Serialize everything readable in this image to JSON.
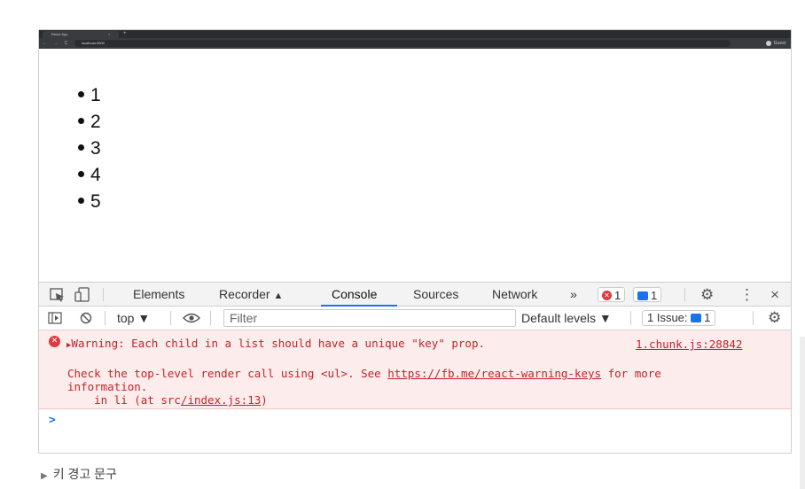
{
  "browser": {
    "tab_title": "React App",
    "tab_close": "×",
    "new_tab": "+",
    "url": "localhost:3000",
    "nav_glyphs": "← → C",
    "profile_label": "Guest"
  },
  "page": {
    "list_items": [
      "1",
      "2",
      "3",
      "4",
      "5"
    ]
  },
  "devtools": {
    "tabs": [
      "Elements",
      "Recorder",
      "Console",
      "Sources",
      "Network"
    ],
    "recorder_glyph": "▲",
    "more_tabs": "»",
    "error_count": "1",
    "message_count": "1",
    "more_menu": "⋮",
    "close": "×",
    "gear": "⚙",
    "context": "top ▼",
    "filter_placeholder": "Filter",
    "default_levels": "Default levels ▼",
    "issues_label": "1 Issue:",
    "issues_count": "1",
    "warning": {
      "icon": "✕",
      "arrow": "▶",
      "title": "Warning: Each child in a list should have a unique \"key\" prop.",
      "source": "1.chunk.js:28842",
      "line2_pre": "Check the top-level render call using <ul>. See ",
      "line2_link": "https://fb.me/react-warning-keys",
      "line2_post": " for more",
      "line3": "information.",
      "line4_pre": "    in li (at src",
      "line4_link": "/index.js:13",
      "line4_post": ")"
    },
    "prompt": ">"
  },
  "caption": {
    "marker": "▶",
    "text": "키 경고 문구"
  },
  "colors": {
    "accent": "#1a73e8",
    "error": "#c4242a",
    "error_bg": "#fcecec"
  }
}
